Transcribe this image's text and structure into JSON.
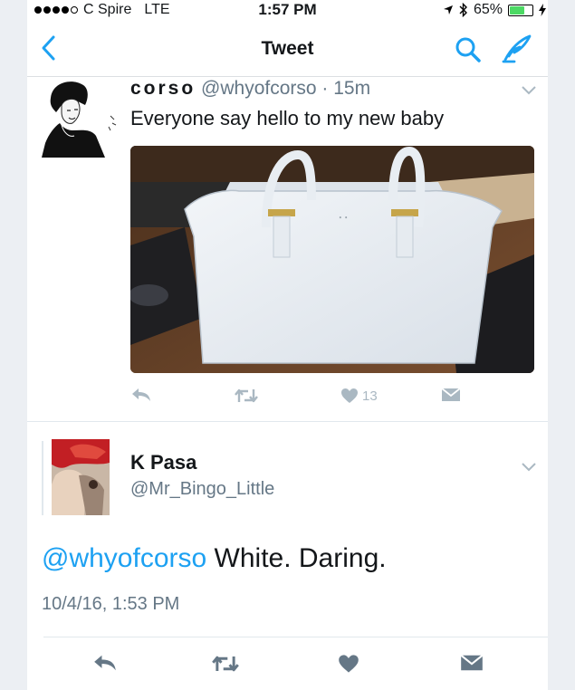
{
  "status_bar": {
    "carrier": "C Spire",
    "network": "LTE",
    "time": "1:57 PM",
    "battery": "65%",
    "signal_bars_filled": 4,
    "signal_bars_total": 5,
    "battery_level": 0.65
  },
  "nav": {
    "title": "Tweet"
  },
  "tweet": {
    "name": "corso",
    "handle": "@whyofcorso",
    "separator": "·",
    "time_ago": "15m",
    "text": "Everyone say hello to my new baby",
    "like_count": "13"
  },
  "reply": {
    "name": "K Pasa",
    "handle": "@Mr_Bingo_Little",
    "mention": "@whyofcorso",
    "text": " White. Daring.",
    "date": "10/4/16, 1:53 PM"
  },
  "colors": {
    "accent": "#1da1f2",
    "muted": "#657786",
    "icon_gray": "#aab8c2",
    "action_dark": "#657786"
  }
}
